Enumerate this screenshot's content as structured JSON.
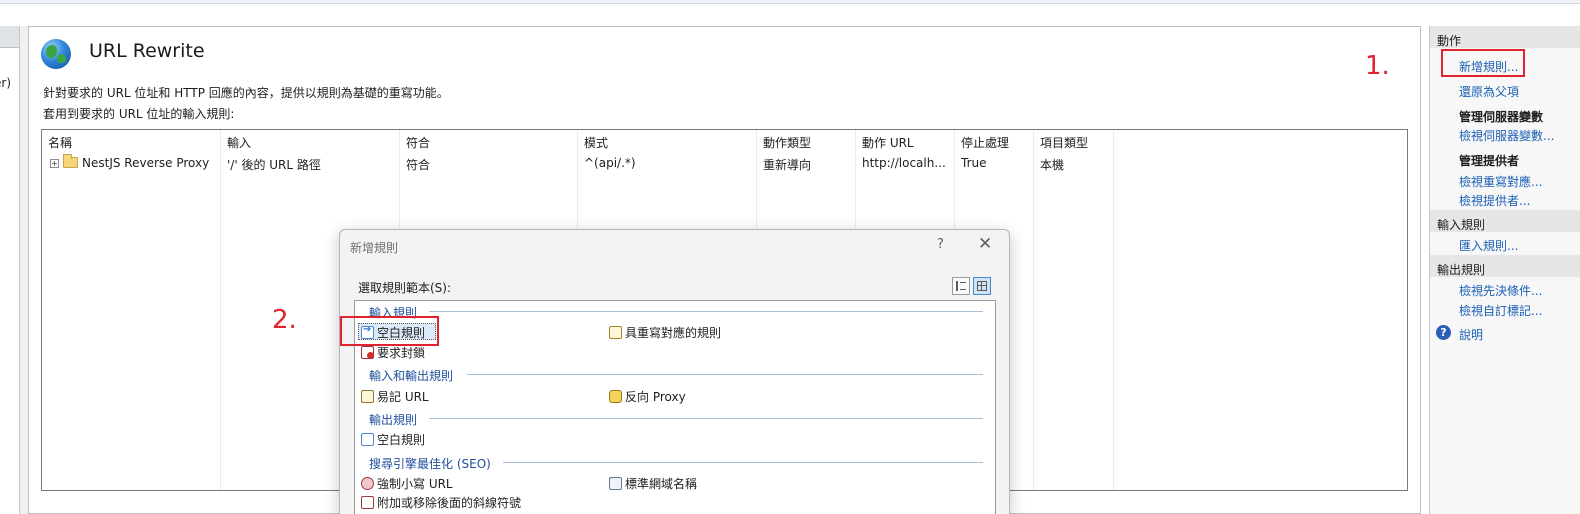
{
  "left_pane": {
    "fragment_text": "er)"
  },
  "main": {
    "title": "URL Rewrite",
    "description": "針對要求的 URL 位址和 HTTP 回應的內容，提供以規則為基礎的重寫功能。",
    "rules_label": "套用到要求的 URL 位址的輸入規則:",
    "columns": [
      "名稱",
      "輸入",
      "符合",
      "模式",
      "動作類型",
      "動作 URL",
      "停止處理",
      "項目類型"
    ],
    "rows": [
      {
        "name": "NestJS Reverse Proxy",
        "input": "'/' 後的 URL 路徑",
        "match": "符合",
        "pattern": "^(api/.*)",
        "action_type": "重新導向",
        "action_url": "http://localh...",
        "stop": "True",
        "entry_type": "本機"
      }
    ]
  },
  "actions": {
    "header": "動作",
    "add_rules": "新增規則...",
    "revert_parent": "還原為父項",
    "server_vars_title": "管理伺服器變數",
    "view_server_vars": "檢視伺服器變數...",
    "providers_title": "管理提供者",
    "view_rewrite_maps": "檢視重寫對應...",
    "view_providers": "檢視提供者...",
    "inbound_header": "輸入規則",
    "import_rules": "匯入規則...",
    "outbound_header": "輸出規則",
    "view_preconditions": "檢視先決條件...",
    "view_custom_tags": "檢視自訂標記...",
    "help": "說明"
  },
  "annotations": {
    "step1": "1.",
    "step2": "2."
  },
  "dialog": {
    "title": "新增規則",
    "help_symbol": "?",
    "close_symbol": "✕",
    "select_label": "選取規則範本(S):",
    "groups": {
      "inbound": "輸入規則",
      "in_out": "輸入和輸出規則",
      "outbound": "輸出規則",
      "seo": "搜尋引擎最佳化 (SEO)"
    },
    "templates": {
      "blank_rule": "空白規則",
      "rule_with_map": "具重寫對應的規則",
      "request_blocking": "要求封鎖",
      "user_friendly_url": "易記 URL",
      "reverse_proxy": "反向 Proxy",
      "outbound_blank_rule": "空白規則",
      "lowercase_url": "強制小寫 URL",
      "canonical_domain": "標準網域名稱",
      "trailing_slash": "附加或移除後面的斜線符號"
    }
  },
  "colors": {
    "annotation_red": "#e0242f",
    "link_blue": "#1a5fb4",
    "group_blue": "#1f4e9c"
  }
}
